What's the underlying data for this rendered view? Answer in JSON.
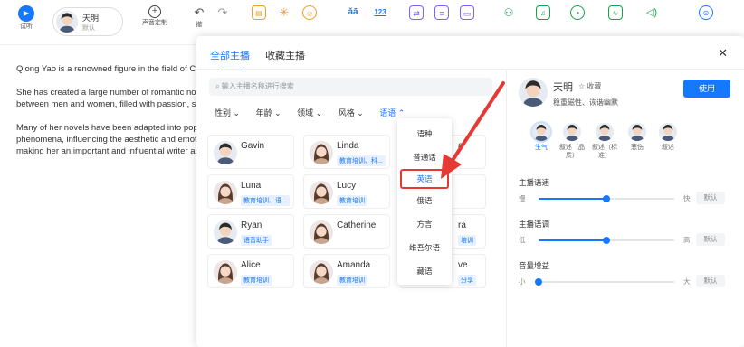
{
  "toolbar": {
    "play_label": "试听",
    "voice_name": "天明",
    "voice_sub": "默认",
    "custom_label": "声音定制",
    "undo_label": "撤",
    "pinyin_1": "ǎā",
    "pinyin_2": "123"
  },
  "document": {
    "para1": "Qiong Yao is a renowned figure in the field of Chin",
    "para2a": "She has created a large number of romantic nove",
    "para2b": "between men and women, filled with passion, sac",
    "para3a": "Many of her novels have been adapted into popu",
    "para3b": "phenomena, influencing the aesthetic and emoti",
    "para3c": "making her an important and influential writer an"
  },
  "panel": {
    "tab_all": "全部主播",
    "tab_fav": "收藏主播",
    "close": "✕",
    "search_placeholder": "输入主播名称进行搜索",
    "filters": [
      "性别 ⌄",
      "年龄 ⌄",
      "领域 ⌄",
      "风格 ⌄",
      "语语 ⌃"
    ]
  },
  "anchors": [
    {
      "name": "Gavin",
      "tag": ""
    },
    {
      "name": "Linda",
      "tag": "教育培训、科..."
    },
    {
      "name": "Luna",
      "tag": "教育培训、语..."
    },
    {
      "name": "Lucy",
      "tag": "教育培训"
    },
    {
      "name": "Ryan",
      "tag": "语音助手"
    },
    {
      "name": "Catherine",
      "tag": ""
    },
    {
      "name": "Alice",
      "tag": "教育培训"
    },
    {
      "name": "Amanda",
      "tag": "教育培训"
    }
  ],
  "partial_cards": {
    "row1_tag": "a",
    "row3_name": "ra",
    "row3_tag": "培训",
    "row4_name": "ve",
    "row4_tag": "分享"
  },
  "dropdown": {
    "items": [
      "语种",
      "普通话",
      "英语",
      "俄语",
      "方言",
      "维吾尔语",
      "藏语"
    ],
    "selected_index": 2
  },
  "detail": {
    "name": "天明",
    "fav": "☆ 收藏",
    "desc": "稳重磁性、诙谐幽默",
    "use_button": "使用",
    "emotions": [
      "生气",
      "叙述（品质）",
      "叙述（标准）",
      "悲伤",
      "叙述"
    ],
    "active_emotion": 0,
    "sliders": [
      {
        "title": "主播语速",
        "low": "慢",
        "high": "快",
        "default": "默认",
        "value": 0.5
      },
      {
        "title": "主播语调",
        "low": "低",
        "high": "高",
        "default": "默认",
        "value": 0.5
      },
      {
        "title": "音量增益",
        "low": "小",
        "high": "大",
        "default": "默认",
        "value": 0.0
      }
    ]
  },
  "colors": {
    "accent": "#1677ff",
    "highlight": "#e53935"
  }
}
